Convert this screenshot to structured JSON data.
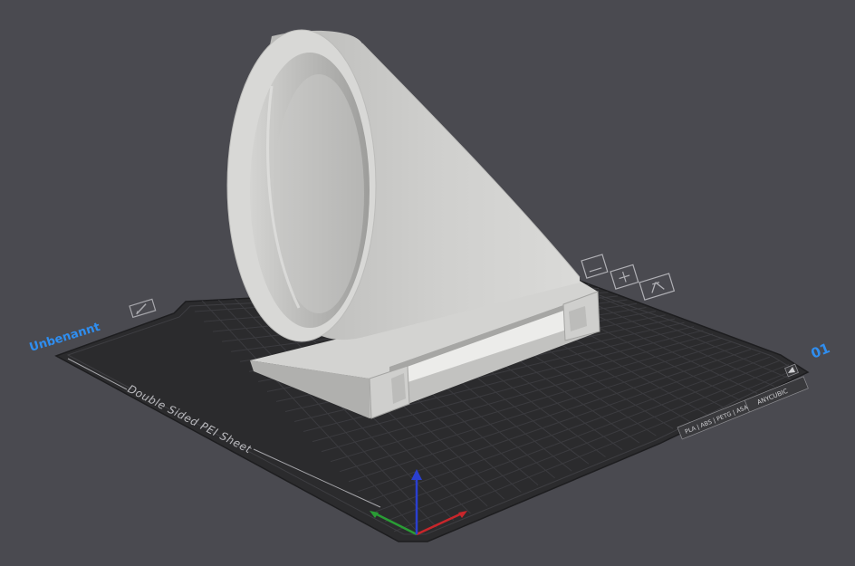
{
  "plate": {
    "name": "Unbenannt",
    "number": "01",
    "sheet_label": "Double Sided PEI Sheet",
    "material_label": "PLA | ABS | PETG | ASA",
    "brand_label": "ANYCUBIC",
    "edit_icon": "pencil-icon"
  },
  "toolbar_icons": [
    "plate-arrange-icon",
    "plate-orient-icon",
    "plate-settings-icon"
  ],
  "axes": [
    "x-axis-red",
    "y-axis-green",
    "z-axis-blue"
  ],
  "colors": {
    "background": "#4a4a50",
    "bed": "#2b2b2d",
    "grid": "#3a3a3e",
    "model": "#c9c9c7",
    "accent": "#2f8ef0",
    "x_axis": "#c8262b",
    "y_axis": "#2a9c35",
    "z_axis": "#2a3fd0"
  }
}
